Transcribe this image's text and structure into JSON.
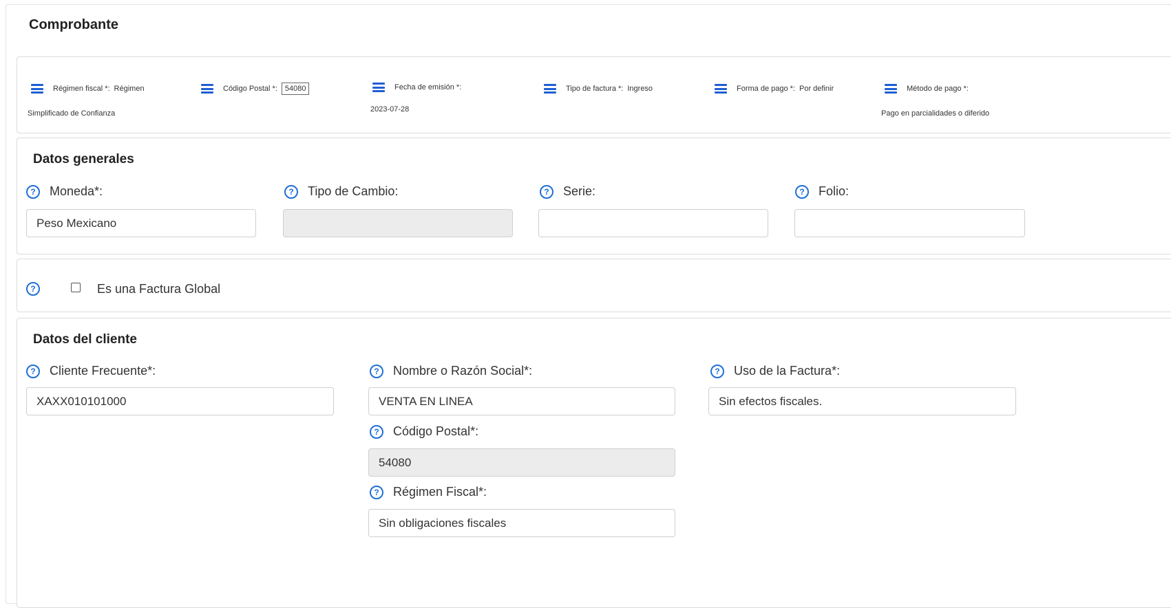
{
  "comprobante": {
    "title": "Comprobante",
    "regimen": {
      "label": "Régimen fiscal *:",
      "value_part1": "Régimen",
      "value_part2": "Simplificado de Confianza"
    },
    "codigo_postal": {
      "label": "Código Postal *:",
      "value": "54080"
    },
    "fecha": {
      "label": "Fecha de emisión *:",
      "value": "2023-07-28"
    },
    "tipo_factura": {
      "label": "Tipo de factura *:",
      "value": "Ingreso"
    },
    "forma_pago": {
      "label": "Forma de pago *:",
      "value": "Por definir"
    },
    "metodo_pago": {
      "label": "Método de pago *:",
      "value": "Pago en parcialidades o diferido"
    }
  },
  "datos_generales": {
    "title": "Datos generales",
    "moneda": {
      "label": "Moneda*:",
      "value": "Peso Mexicano"
    },
    "tipo_cambio": {
      "label": "Tipo de Cambio:",
      "value": ""
    },
    "serie": {
      "label": "Serie:",
      "value": ""
    },
    "folio": {
      "label": "Folio:",
      "value": ""
    }
  },
  "factura_global": {
    "label": "Es una Factura Global",
    "checked": false
  },
  "datos_cliente": {
    "title": "Datos del cliente",
    "cliente_frecuente": {
      "label": "Cliente Frecuente*:",
      "value": "XAXX010101000"
    },
    "nombre": {
      "label": "Nombre o Razón Social*:",
      "value": "VENTA EN LINEA"
    },
    "uso_factura": {
      "label": "Uso de la Factura*:",
      "value": "Sin efectos fiscales."
    },
    "codigo_postal": {
      "label": "Código Postal*:",
      "value": "54080"
    },
    "regimen_fiscal": {
      "label": "Régimen Fiscal*:",
      "value": "Sin obligaciones fiscales"
    }
  },
  "icons": {
    "menu": "menu-icon",
    "help": "help-icon"
  },
  "colors": {
    "accent": "#1e6fd8",
    "readonly_bg": "#ececec"
  }
}
